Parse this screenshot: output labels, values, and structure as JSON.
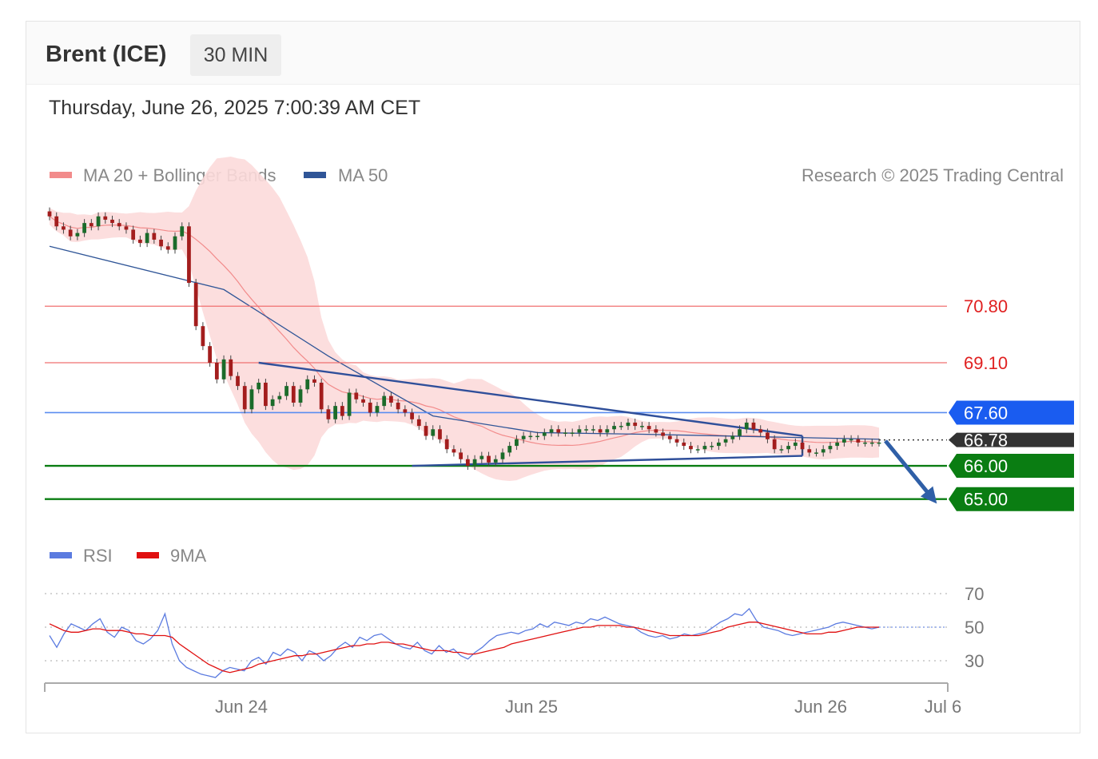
{
  "header": {
    "title": "Brent (ICE)",
    "timeframe": "30 MIN",
    "datetime": "Thursday, June 26, 2025 7:00:39 AM CET",
    "copyright": "Research © 2025 Trading Central"
  },
  "legend_price": [
    {
      "label": "MA 20 + Bollinger Bands",
      "color": "#f28b8b"
    },
    {
      "label": "MA 50",
      "color": "#2f5597"
    }
  ],
  "legend_rsi": [
    {
      "label": "RSI",
      "color": "#5b7be0"
    },
    {
      "label": "9MA",
      "color": "#e01010"
    }
  ],
  "colors": {
    "up_candle": "#1b6b2a",
    "down_candle": "#a31d1d",
    "bollinger_fill": "#fcdada",
    "resistance": "#f07070",
    "pivot": "#1a5cf0",
    "support": "#0a7d12",
    "trendline": "#2f4f9a"
  },
  "chart_data": [
    {
      "type": "candlestick",
      "title": "Brent (ICE)",
      "x_tick_labels": [
        "Jun 24",
        "Jun 25",
        "Jun 26",
        "Jul 6"
      ],
      "price_range": [
        64.2,
        74.0
      ],
      "levels": [
        {
          "label": "70.80",
          "value": 70.8,
          "kind": "resistance"
        },
        {
          "label": "69.10",
          "value": 69.1,
          "kind": "resistance"
        },
        {
          "label": "67.60",
          "value": 67.6,
          "kind": "pivot"
        },
        {
          "label": "66.78",
          "value": 66.78,
          "kind": "last"
        },
        {
          "label": "66.00",
          "value": 66.0,
          "kind": "support"
        },
        {
          "label": "65.00",
          "value": 65.0,
          "kind": "support"
        }
      ],
      "close": [
        73.5,
        73.2,
        73.1,
        72.9,
        73.0,
        73.3,
        73.2,
        73.5,
        73.4,
        73.3,
        73.2,
        73.1,
        72.8,
        72.7,
        73.0,
        72.8,
        72.6,
        72.5,
        72.9,
        73.2,
        71.5,
        70.2,
        69.6,
        69.1,
        68.6,
        69.2,
        68.7,
        68.4,
        67.7,
        68.3,
        68.5,
        67.8,
        68.0,
        68.1,
        68.4,
        67.9,
        68.3,
        68.6,
        68.5,
        67.7,
        67.4,
        67.8,
        67.5,
        68.2,
        68.0,
        67.9,
        67.6,
        67.8,
        68.1,
        67.9,
        67.7,
        67.6,
        67.4,
        67.2,
        66.9,
        67.1,
        66.8,
        66.5,
        66.4,
        66.2,
        66.0,
        66.2,
        66.3,
        66.1,
        66.2,
        66.4,
        66.6,
        66.8,
        66.9,
        66.9,
        66.9,
        67.0,
        67.1,
        67.0,
        67.0,
        67.0,
        67.1,
        67.1,
        67.1,
        67.0,
        67.1,
        67.2,
        67.2,
        67.3,
        67.2,
        67.2,
        67.1,
        67.0,
        66.9,
        66.8,
        66.7,
        66.6,
        66.5,
        66.5,
        66.6,
        66.6,
        66.7,
        66.8,
        66.9,
        67.1,
        67.3,
        67.1,
        67.0,
        66.8,
        66.5,
        66.5,
        66.6,
        66.7,
        66.5,
        66.4,
        66.4,
        66.5,
        66.6,
        66.7,
        66.8,
        66.8,
        66.7,
        66.7,
        66.7,
        66.7
      ],
      "ma50": [
        {
          "x": 0,
          "y": 72.6
        },
        {
          "x": 25,
          "y": 71.3
        },
        {
          "x": 40,
          "y": 69.3
        },
        {
          "x": 55,
          "y": 67.5
        },
        {
          "x": 70,
          "y": 67.0
        },
        {
          "x": 85,
          "y": 66.95
        },
        {
          "x": 119,
          "y": 66.8
        }
      ],
      "trendlines": [
        {
          "from": {
            "x": 30,
            "y": 69.1
          },
          "to": {
            "x": 108,
            "y": 66.9
          }
        },
        {
          "from": {
            "x": 52,
            "y": 66.0
          },
          "to": {
            "x": 108,
            "y": 66.3
          }
        },
        {
          "from": {
            "x": 108,
            "y": 66.9
          },
          "to": {
            "x": 108,
            "y": 66.3
          }
        }
      ],
      "forecast_arrow": {
        "from": 66.75,
        "to": 65.0
      }
    },
    {
      "type": "line",
      "title": "RSI",
      "y_tick_labels": [
        "70",
        "50",
        "30"
      ],
      "ylim": [
        20,
        80
      ],
      "series": [
        {
          "name": "RSI",
          "values": [
            45,
            38,
            46,
            52,
            50,
            48,
            52,
            55,
            47,
            44,
            50,
            48,
            42,
            40,
            43,
            48,
            58,
            40,
            30,
            26,
            24,
            22,
            21,
            20,
            24,
            26,
            25,
            24,
            30,
            32,
            28,
            35,
            33,
            37,
            35,
            30,
            36,
            34,
            30,
            33,
            38,
            41,
            38,
            44,
            42,
            45,
            46,
            43,
            40,
            38,
            37,
            41,
            36,
            34,
            39,
            35,
            37,
            33,
            31,
            35,
            38,
            42,
            45,
            46,
            47,
            46,
            48,
            49,
            52,
            50,
            53,
            52,
            51,
            53,
            52,
            55,
            54,
            56,
            54,
            52,
            51,
            50,
            47,
            45,
            44,
            45,
            43,
            44,
            46,
            45,
            46,
            47,
            50,
            53,
            55,
            58,
            57,
            61,
            54,
            50,
            49,
            48,
            46,
            45,
            46,
            47,
            48,
            49,
            50,
            52,
            53,
            52,
            51,
            50,
            49,
            50
          ]
        },
        {
          "name": "9MA",
          "values": [
            52,
            50,
            48,
            47,
            47,
            48,
            49,
            49,
            48,
            48,
            48,
            47,
            46,
            46,
            45,
            45,
            45,
            44,
            40,
            37,
            34,
            31,
            28,
            26,
            24,
            23,
            24,
            25,
            26,
            28,
            29,
            30,
            31,
            32,
            33,
            33,
            34,
            34,
            35,
            36,
            37,
            38,
            39,
            39,
            40,
            40,
            41,
            41,
            40,
            40,
            39,
            38,
            37,
            36,
            36,
            36,
            35,
            35,
            34,
            34,
            35,
            36,
            37,
            38,
            40,
            41,
            42,
            43,
            44,
            45,
            46,
            47,
            48,
            49,
            50,
            50,
            51,
            51,
            51,
            51,
            50,
            50,
            49,
            48,
            47,
            46,
            45,
            45,
            45,
            45,
            45,
            46,
            47,
            48,
            50,
            51,
            52,
            53,
            53,
            52,
            51,
            50,
            49,
            48,
            47,
            46,
            46,
            46,
            47,
            47,
            48,
            49,
            50,
            50,
            50,
            50
          ]
        }
      ]
    }
  ]
}
